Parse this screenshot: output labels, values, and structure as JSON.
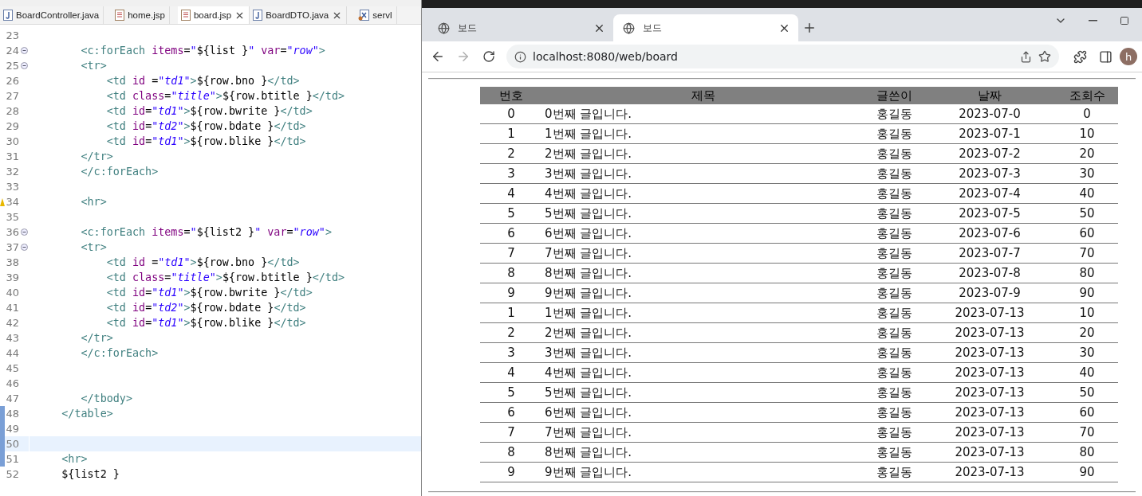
{
  "editor": {
    "tabs": [
      {
        "label": "BoardController.java",
        "kind": "java",
        "selected": false,
        "closable": false
      },
      {
        "label": "home.jsp",
        "kind": "jsp",
        "selected": false,
        "closable": false
      },
      {
        "label": "board.jsp",
        "kind": "jsp",
        "selected": true,
        "closable": true
      },
      {
        "label": "BoardDTO.java",
        "kind": "java",
        "selected": false,
        "closable": true
      },
      {
        "label": "servl",
        "kind": "xml",
        "selected": false,
        "closable": false
      }
    ],
    "lines": [
      {
        "number": "23",
        "fold": false,
        "warning": false,
        "current": false,
        "changed": false
      },
      {
        "number": "24",
        "fold": true,
        "warning": false,
        "current": false,
        "changed": false,
        "tokens": [
          {
            "kind": "tag",
            "text": "        <c:forEach"
          },
          {
            "kind": "attr",
            "text": " items"
          },
          {
            "kind": "plain",
            "text": "="
          },
          {
            "kind": "str",
            "text": "\""
          },
          {
            "kind": "plain",
            "text": "${list }"
          },
          {
            "kind": "str",
            "text": "\""
          },
          {
            "kind": "attr",
            "text": " var"
          },
          {
            "kind": "plain",
            "text": "="
          },
          {
            "kind": "str",
            "text": "\"row\""
          },
          {
            "kind": "tag",
            "text": ">"
          }
        ]
      },
      {
        "number": "25",
        "fold": true,
        "warning": false,
        "current": false,
        "changed": false,
        "tokens": [
          {
            "kind": "tag",
            "text": "        <tr>"
          }
        ]
      },
      {
        "number": "26",
        "fold": false,
        "warning": false,
        "current": false,
        "changed": false,
        "tokens": [
          {
            "kind": "tag",
            "text": "            <td"
          },
          {
            "kind": "attr",
            "text": " id"
          },
          {
            "kind": "plain",
            "text": " ="
          },
          {
            "kind": "str",
            "text": "\"td1\""
          },
          {
            "kind": "tag",
            "text": ">"
          },
          {
            "kind": "plain",
            "text": "${row.bno }"
          },
          {
            "kind": "tag",
            "text": "</td>"
          }
        ]
      },
      {
        "number": "27",
        "fold": false,
        "warning": false,
        "current": false,
        "changed": false,
        "tokens": [
          {
            "kind": "tag",
            "text": "            <td"
          },
          {
            "kind": "attr",
            "text": " class"
          },
          {
            "kind": "plain",
            "text": "="
          },
          {
            "kind": "str",
            "text": "\"title\""
          },
          {
            "kind": "tag",
            "text": ">"
          },
          {
            "kind": "plain",
            "text": "${row.btitle }"
          },
          {
            "kind": "tag",
            "text": "</td>"
          }
        ]
      },
      {
        "number": "28",
        "fold": false,
        "warning": false,
        "current": false,
        "changed": false,
        "tokens": [
          {
            "kind": "tag",
            "text": "            <td"
          },
          {
            "kind": "attr",
            "text": " id"
          },
          {
            "kind": "plain",
            "text": "="
          },
          {
            "kind": "str",
            "text": "\"td1\""
          },
          {
            "kind": "tag",
            "text": ">"
          },
          {
            "kind": "plain",
            "text": "${row.bwrite }"
          },
          {
            "kind": "tag",
            "text": "</td>"
          }
        ]
      },
      {
        "number": "29",
        "fold": false,
        "warning": false,
        "current": false,
        "changed": false,
        "tokens": [
          {
            "kind": "tag",
            "text": "            <td"
          },
          {
            "kind": "attr",
            "text": " id"
          },
          {
            "kind": "plain",
            "text": "="
          },
          {
            "kind": "str",
            "text": "\"td2\""
          },
          {
            "kind": "tag",
            "text": ">"
          },
          {
            "kind": "plain",
            "text": "${row.bdate }"
          },
          {
            "kind": "tag",
            "text": "</td>"
          }
        ]
      },
      {
        "number": "30",
        "fold": false,
        "warning": false,
        "current": false,
        "changed": false,
        "tokens": [
          {
            "kind": "tag",
            "text": "            <td"
          },
          {
            "kind": "attr",
            "text": " id"
          },
          {
            "kind": "plain",
            "text": "="
          },
          {
            "kind": "str",
            "text": "\"td1\""
          },
          {
            "kind": "tag",
            "text": ">"
          },
          {
            "kind": "plain",
            "text": "${row.blike }"
          },
          {
            "kind": "tag",
            "text": "</td>"
          }
        ]
      },
      {
        "number": "31",
        "fold": false,
        "warning": false,
        "current": false,
        "changed": false,
        "tokens": [
          {
            "kind": "tag",
            "text": "        </tr>"
          }
        ]
      },
      {
        "number": "32",
        "fold": false,
        "warning": false,
        "current": false,
        "changed": false,
        "tokens": [
          {
            "kind": "tag",
            "text": "        </c:forEach>"
          }
        ]
      },
      {
        "number": "33",
        "fold": false,
        "warning": false,
        "current": false,
        "changed": false
      },
      {
        "number": "34",
        "fold": false,
        "warning": true,
        "current": false,
        "changed": false,
        "tokens": [
          {
            "kind": "tag",
            "text": "        <hr>"
          }
        ]
      },
      {
        "number": "35",
        "fold": false,
        "warning": false,
        "current": false,
        "changed": false
      },
      {
        "number": "36",
        "fold": true,
        "warning": false,
        "current": false,
        "changed": false,
        "tokens": [
          {
            "kind": "tag",
            "text": "        <c:forEach"
          },
          {
            "kind": "attr",
            "text": " items"
          },
          {
            "kind": "plain",
            "text": "="
          },
          {
            "kind": "str",
            "text": "\""
          },
          {
            "kind": "plain",
            "text": "${list2 }"
          },
          {
            "kind": "str",
            "text": "\""
          },
          {
            "kind": "attr",
            "text": " var"
          },
          {
            "kind": "plain",
            "text": "="
          },
          {
            "kind": "str",
            "text": "\"row\""
          },
          {
            "kind": "tag",
            "text": ">"
          }
        ]
      },
      {
        "number": "37",
        "fold": true,
        "warning": false,
        "current": false,
        "changed": false,
        "tokens": [
          {
            "kind": "tag",
            "text": "        <tr>"
          }
        ]
      },
      {
        "number": "38",
        "fold": false,
        "warning": false,
        "current": false,
        "changed": false,
        "tokens": [
          {
            "kind": "tag",
            "text": "            <td"
          },
          {
            "kind": "attr",
            "text": " id"
          },
          {
            "kind": "plain",
            "text": " ="
          },
          {
            "kind": "str",
            "text": "\"td1\""
          },
          {
            "kind": "tag",
            "text": ">"
          },
          {
            "kind": "plain",
            "text": "${row.bno }"
          },
          {
            "kind": "tag",
            "text": "</td>"
          }
        ]
      },
      {
        "number": "39",
        "fold": false,
        "warning": false,
        "current": false,
        "changed": false,
        "tokens": [
          {
            "kind": "tag",
            "text": "            <td"
          },
          {
            "kind": "attr",
            "text": " class"
          },
          {
            "kind": "plain",
            "text": "="
          },
          {
            "kind": "str",
            "text": "\"title\""
          },
          {
            "kind": "tag",
            "text": ">"
          },
          {
            "kind": "plain",
            "text": "${row.btitle }"
          },
          {
            "kind": "tag",
            "text": "</td>"
          }
        ]
      },
      {
        "number": "40",
        "fold": false,
        "warning": false,
        "current": false,
        "changed": false,
        "tokens": [
          {
            "kind": "tag",
            "text": "            <td"
          },
          {
            "kind": "attr",
            "text": " id"
          },
          {
            "kind": "plain",
            "text": "="
          },
          {
            "kind": "str",
            "text": "\"td1\""
          },
          {
            "kind": "tag",
            "text": ">"
          },
          {
            "kind": "plain",
            "text": "${row.bwrite }"
          },
          {
            "kind": "tag",
            "text": "</td>"
          }
        ]
      },
      {
        "number": "41",
        "fold": false,
        "warning": false,
        "current": false,
        "changed": false,
        "tokens": [
          {
            "kind": "tag",
            "text": "            <td"
          },
          {
            "kind": "attr",
            "text": " id"
          },
          {
            "kind": "plain",
            "text": "="
          },
          {
            "kind": "str",
            "text": "\"td2\""
          },
          {
            "kind": "tag",
            "text": ">"
          },
          {
            "kind": "plain",
            "text": "${row.bdate }"
          },
          {
            "kind": "tag",
            "text": "</td>"
          }
        ]
      },
      {
        "number": "42",
        "fold": false,
        "warning": false,
        "current": false,
        "changed": false,
        "tokens": [
          {
            "kind": "tag",
            "text": "            <td"
          },
          {
            "kind": "attr",
            "text": " id"
          },
          {
            "kind": "plain",
            "text": "="
          },
          {
            "kind": "str",
            "text": "\"td1\""
          },
          {
            "kind": "tag",
            "text": ">"
          },
          {
            "kind": "plain",
            "text": "${row.blike }"
          },
          {
            "kind": "tag",
            "text": "</td>"
          }
        ]
      },
      {
        "number": "43",
        "fold": false,
        "warning": false,
        "current": false,
        "changed": false,
        "tokens": [
          {
            "kind": "tag",
            "text": "        </tr>"
          }
        ]
      },
      {
        "number": "44",
        "fold": false,
        "warning": false,
        "current": false,
        "changed": false,
        "tokens": [
          {
            "kind": "tag",
            "text": "        </c:forEach>"
          }
        ]
      },
      {
        "number": "45",
        "fold": false,
        "warning": false,
        "current": false,
        "changed": false
      },
      {
        "number": "46",
        "fold": false,
        "warning": false,
        "current": false,
        "changed": false
      },
      {
        "number": "47",
        "fold": false,
        "warning": false,
        "current": false,
        "changed": false,
        "tokens": [
          {
            "kind": "tag",
            "text": "        </tbody>"
          }
        ]
      },
      {
        "number": "48",
        "fold": false,
        "warning": false,
        "current": false,
        "changed": true,
        "tokens": [
          {
            "kind": "tag",
            "text": "     </table>"
          }
        ]
      },
      {
        "number": "49",
        "fold": false,
        "warning": false,
        "current": false,
        "changed": true
      },
      {
        "number": "50",
        "fold": false,
        "warning": false,
        "current": true,
        "changed": true
      },
      {
        "number": "51",
        "fold": false,
        "warning": false,
        "current": false,
        "changed": true,
        "tokens": [
          {
            "kind": "tag",
            "text": "     <hr>"
          }
        ]
      },
      {
        "number": "52",
        "fold": false,
        "warning": false,
        "current": false,
        "changed": false,
        "tokens": [
          {
            "kind": "plain",
            "text": "     ${list2 }"
          }
        ]
      }
    ]
  },
  "browser": {
    "tabs": [
      {
        "title": "보드",
        "selected": false
      },
      {
        "title": "보드",
        "selected": true
      }
    ],
    "forward_enabled": false,
    "url": "localhost:8080/web/board",
    "profile_initial": "h",
    "table": {
      "columns": [
        "번호",
        "제목",
        "글쓴이",
        "날짜",
        "조회수"
      ],
      "rows": [
        [
          "0",
          "0번째 글입니다.",
          "홍길동",
          "2023-07-0",
          "0"
        ],
        [
          "1",
          "1번째 글입니다.",
          "홍길동",
          "2023-07-1",
          "10"
        ],
        [
          "2",
          "2번째 글입니다.",
          "홍길동",
          "2023-07-2",
          "20"
        ],
        [
          "3",
          "3번째 글입니다.",
          "홍길동",
          "2023-07-3",
          "30"
        ],
        [
          "4",
          "4번째 글입니다.",
          "홍길동",
          "2023-07-4",
          "40"
        ],
        [
          "5",
          "5번째 글입니다.",
          "홍길동",
          "2023-07-5",
          "50"
        ],
        [
          "6",
          "6번째 글입니다.",
          "홍길동",
          "2023-07-6",
          "60"
        ],
        [
          "7",
          "7번째 글입니다.",
          "홍길동",
          "2023-07-7",
          "70"
        ],
        [
          "8",
          "8번째 글입니다.",
          "홍길동",
          "2023-07-8",
          "80"
        ],
        [
          "9",
          "9번째 글입니다.",
          "홍길동",
          "2023-07-9",
          "90"
        ],
        [
          "1",
          "1번째 글입니다.",
          "홍길동",
          "2023-07-13",
          "10"
        ],
        [
          "2",
          "2번째 글입니다.",
          "홍길동",
          "2023-07-13",
          "20"
        ],
        [
          "3",
          "3번째 글입니다.",
          "홍길동",
          "2023-07-13",
          "30"
        ],
        [
          "4",
          "4번째 글입니다.",
          "홍길동",
          "2023-07-13",
          "40"
        ],
        [
          "5",
          "5번째 글입니다.",
          "홍길동",
          "2023-07-13",
          "50"
        ],
        [
          "6",
          "6번째 글입니다.",
          "홍길동",
          "2023-07-13",
          "60"
        ],
        [
          "7",
          "7번째 글입니다.",
          "홍길동",
          "2023-07-13",
          "70"
        ],
        [
          "8",
          "8번째 글입니다.",
          "홍길동",
          "2023-07-13",
          "80"
        ],
        [
          "9",
          "9번째 글입니다.",
          "홍길동",
          "2023-07-13",
          "90"
        ]
      ]
    }
  }
}
